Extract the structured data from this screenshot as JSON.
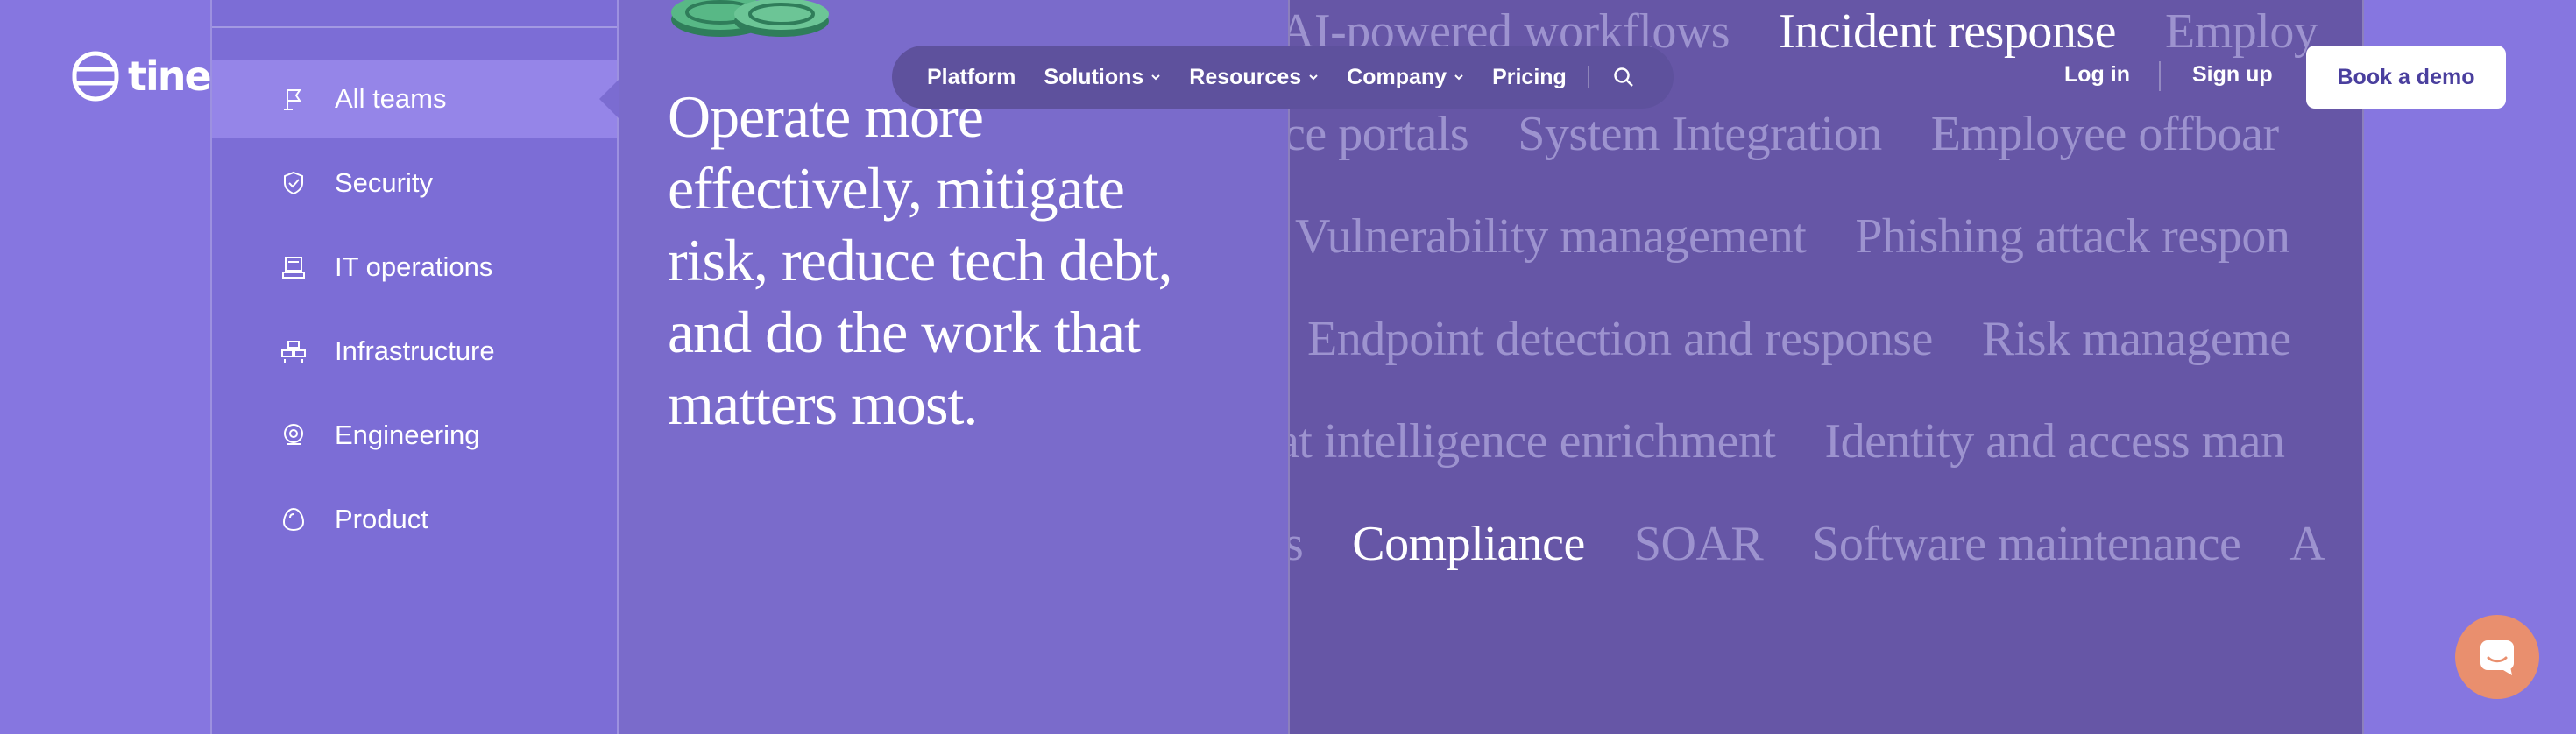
{
  "brand": {
    "name": "tines"
  },
  "sidebar": {
    "items": [
      {
        "label": "All teams",
        "icon": "flag-icon",
        "active": true
      },
      {
        "label": "Security",
        "icon": "shield-icon",
        "active": false
      },
      {
        "label": "IT operations",
        "icon": "computer-icon",
        "active": false
      },
      {
        "label": "Infrastructure",
        "icon": "server-rack-icon",
        "active": false
      },
      {
        "label": "Engineering",
        "icon": "gear-badge-icon",
        "active": false
      },
      {
        "label": "Product",
        "icon": "egg-icon",
        "active": false
      }
    ]
  },
  "main": {
    "headline": "Operate more effectively, mitigate risk, reduce tech debt, and do the work that matters most."
  },
  "word_cloud": {
    "rows": [
      [
        "AI-powered workflows",
        "Incident response",
        "Employ"
      ],
      [
        "ice portals",
        "System Integration",
        "Employee offboar"
      ],
      [
        "Vulnerability management",
        "Phishing attack respon"
      ],
      [
        "Endpoint detection and response",
        "Risk manageme"
      ],
      [
        "at intelligence enrichment",
        "Identity and access man"
      ],
      [
        "s",
        "Compliance",
        "SOAR",
        "Software maintenance",
        "A"
      ]
    ],
    "highlighted": [
      "Incident response",
      "Compliance"
    ]
  },
  "nav": {
    "items": [
      {
        "label": "Platform",
        "has_dropdown": false
      },
      {
        "label": "Solutions",
        "has_dropdown": true
      },
      {
        "label": "Resources",
        "has_dropdown": true
      },
      {
        "label": "Company",
        "has_dropdown": true
      },
      {
        "label": "Pricing",
        "has_dropdown": false
      }
    ]
  },
  "auth": {
    "login": "Log in",
    "signup": "Sign up",
    "demo": "Book a demo"
  },
  "colors": {
    "page_bg": "#8676e0",
    "sidebar_bg": "#7c6dd6",
    "sidebar_active": "#9585e8",
    "middle_bg": "#7a6bcb",
    "cloud_bg": "#6656a6",
    "nav_bg": "#5e519d",
    "chat_bg": "#e98f6e",
    "demo_text": "#4a3f9e"
  }
}
